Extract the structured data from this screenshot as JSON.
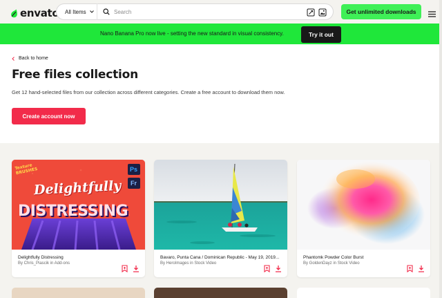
{
  "header": {
    "logo_text": "envato",
    "category_label": "All Items",
    "search_placeholder": "Search",
    "cta_label": "Get unlimited downloads",
    "icons": [
      "envato-leaf-icon",
      "chevron-down-icon",
      "search-icon",
      "image-search-icon",
      "image-search-icon",
      "hamburger-menu-icon"
    ]
  },
  "banner": {
    "headline": "Nano Banana Pro now live",
    "text": " - setting the new standard in visual consistency.",
    "button_label": "Try it out"
  },
  "main": {
    "back_label": "Back to home",
    "title": "Free files collection",
    "description": "Get 12 hand-selected files from our collection across different categories. Create a free account to download them now.",
    "create_button": "Create account now"
  },
  "cards": [
    {
      "title": "Delightfully Distressing",
      "by": "By Chris_Piascik in Add-ons",
      "art_top_text": "Texture BRUSHES",
      "art_line1": "Delightfully",
      "art_line2": "DISTRESSING",
      "badges": [
        "Ps",
        "Fr"
      ]
    },
    {
      "title": "Bavaro, Punta Cana / Dominican Republic - May 19, 2019...",
      "by": "By HeroImages in Stock Video"
    },
    {
      "title": "Phantomk Powder Color Burst",
      "by": "By GoldenDayz in Stock Video"
    }
  ],
  "colors": {
    "accent_green": "#3ff057",
    "banner_green": "#1fe73a",
    "brand_red": "#f22b4a",
    "dark": "#191919"
  }
}
